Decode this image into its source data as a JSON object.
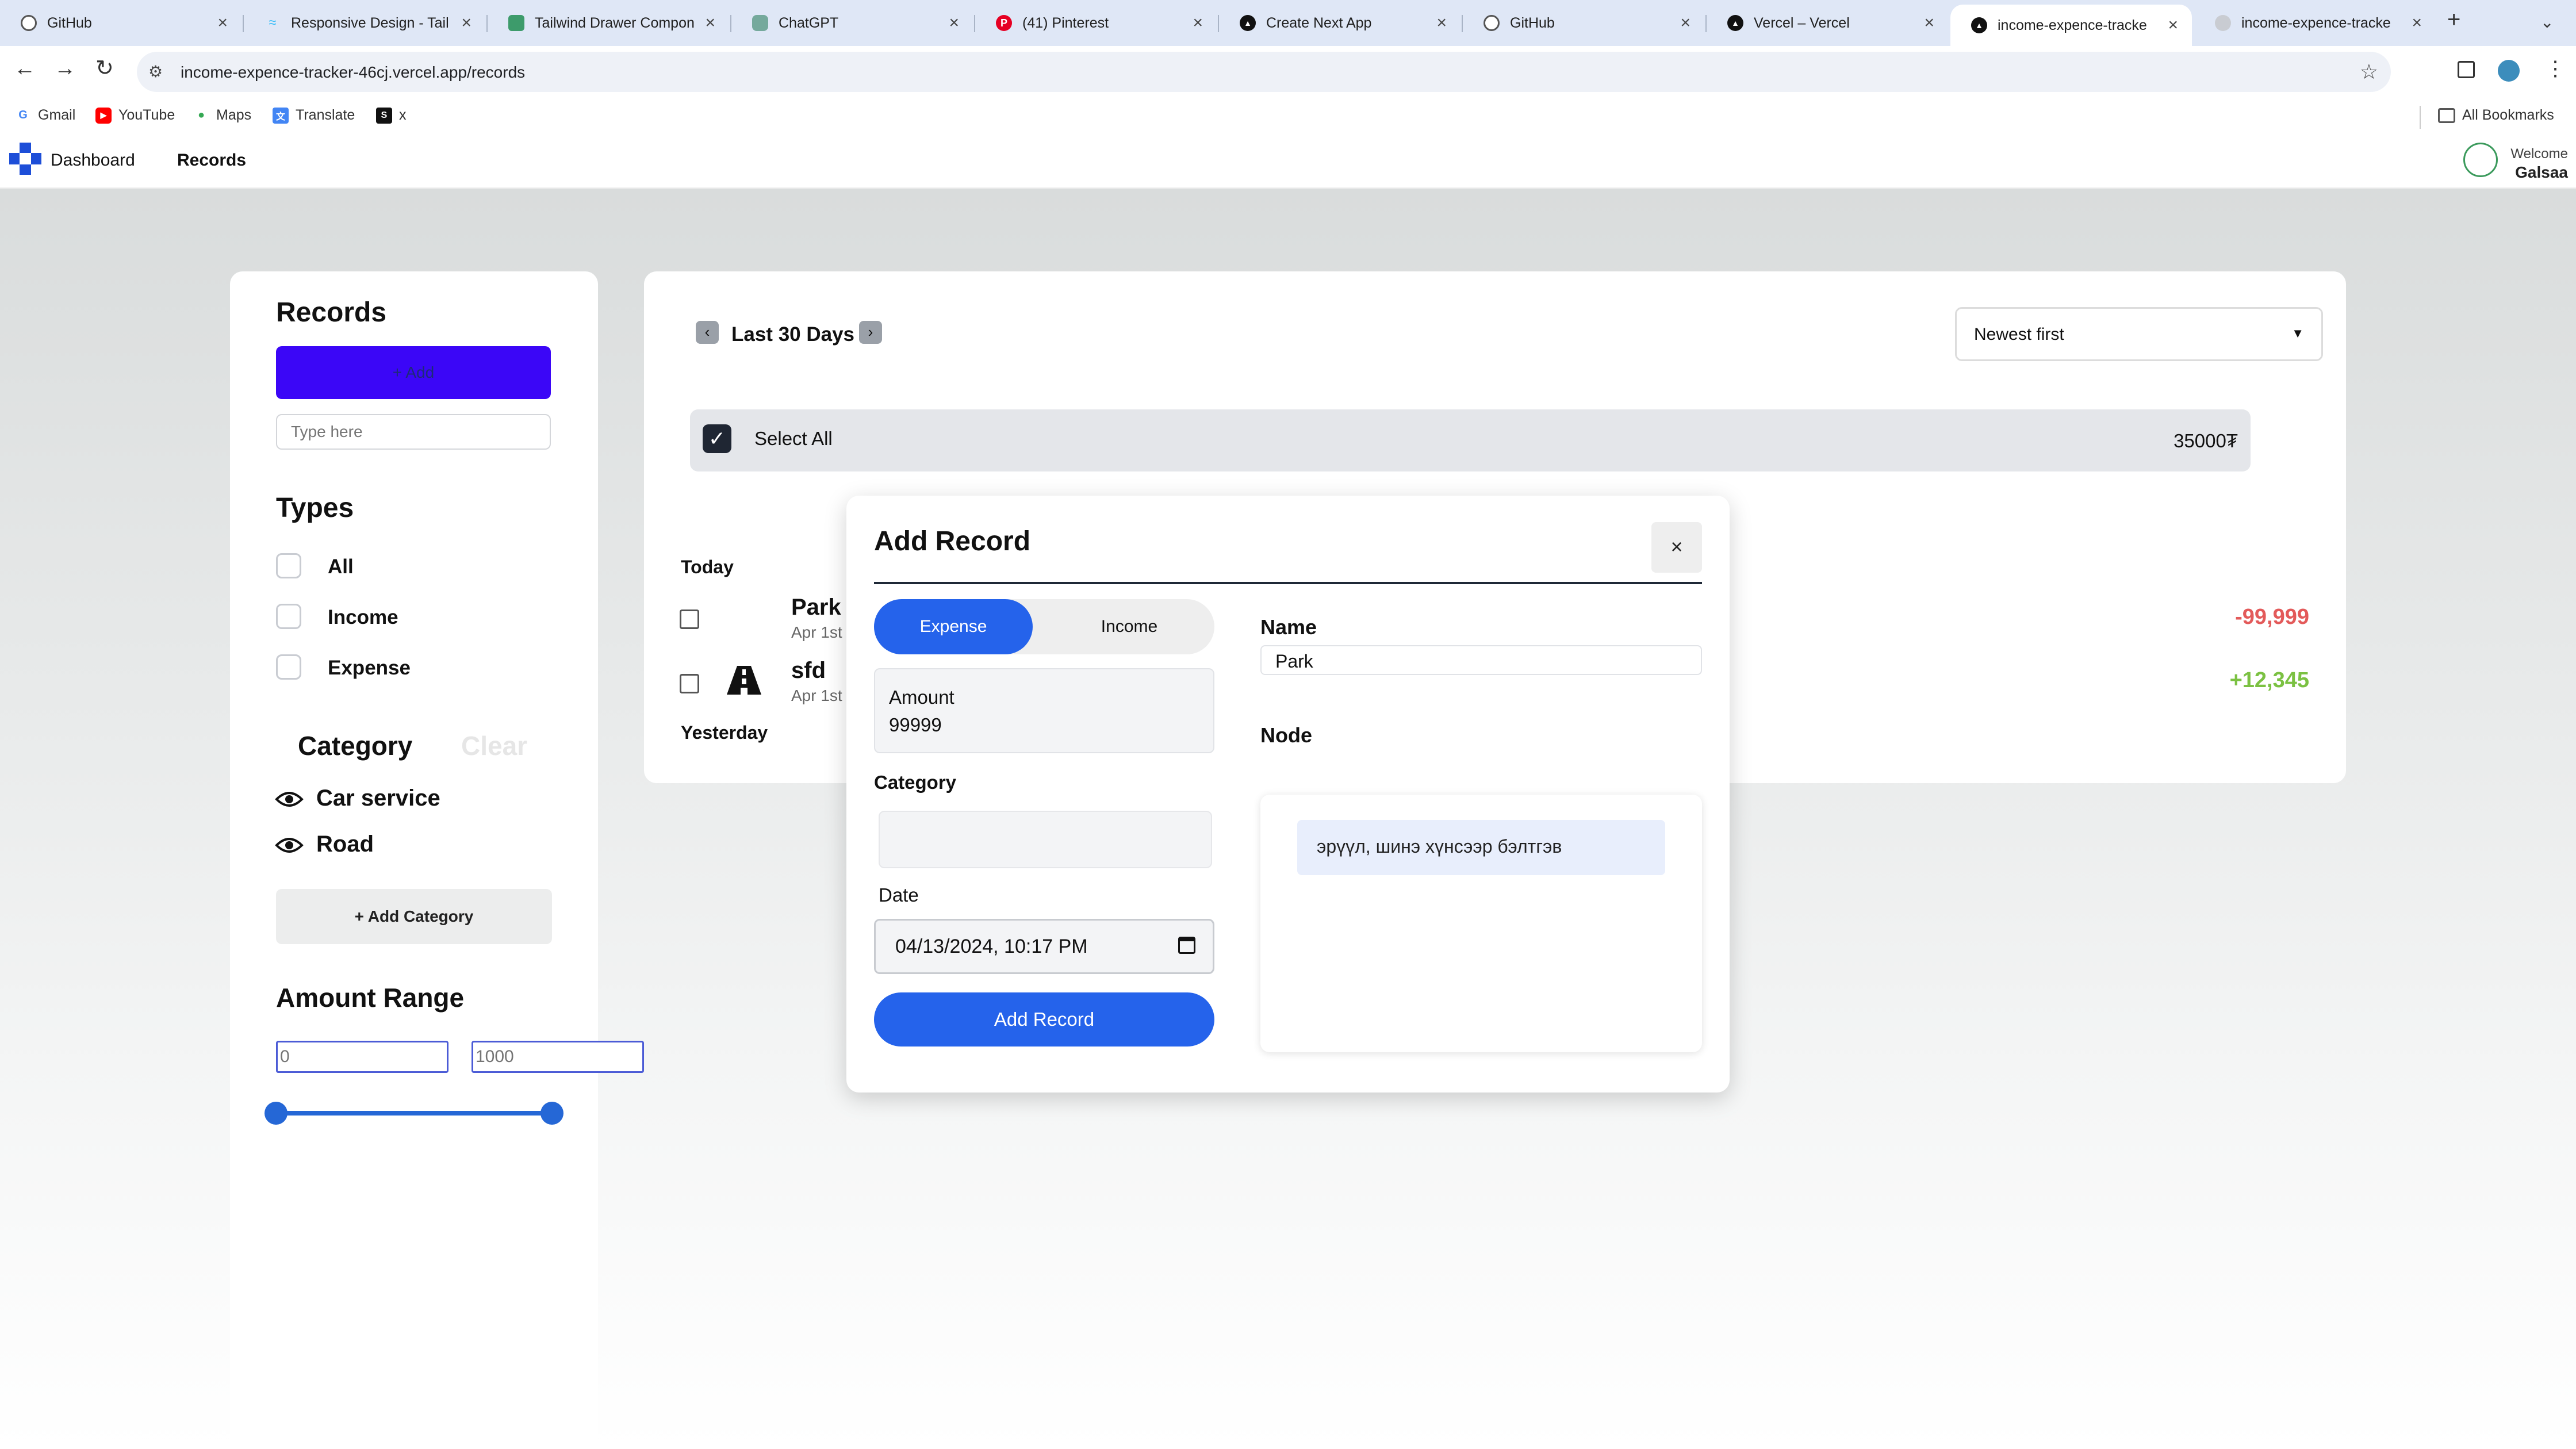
{
  "browser": {
    "tabs": [
      {
        "title": "GitHub",
        "icon": "github-icon"
      },
      {
        "title": "Responsive Design - Tail",
        "icon": "tailwind-icon"
      },
      {
        "title": "Tailwind Drawer Compon",
        "icon": "page-icon"
      },
      {
        "title": "ChatGPT",
        "icon": "chatgpt-icon"
      },
      {
        "title": "(41) Pinterest",
        "icon": "pinterest-icon"
      },
      {
        "title": "Create Next App",
        "icon": "vercel-icon"
      },
      {
        "title": "GitHub",
        "icon": "github-icon"
      },
      {
        "title": "Vercel – Vercel",
        "icon": "vercel-icon"
      },
      {
        "title": "income-expence-tracke",
        "icon": "vercel-icon"
      },
      {
        "title": "income-expence-tracke",
        "icon": "globe-icon"
      }
    ],
    "active_tab_index": 8,
    "url": "income-expence-tracker-46cj.vercel.app/records",
    "bookmarks": [
      "Gmail",
      "YouTube",
      "Maps",
      "Translate",
      "x"
    ],
    "all_bookmarks": "All Bookmarks"
  },
  "app": {
    "nav": {
      "dashboard": "Dashboard",
      "records": "Records"
    },
    "user": {
      "welcome": "Welcome",
      "name": "Galsaa"
    }
  },
  "sidebar": {
    "title": "Records",
    "add_button": "+ Add",
    "search_placeholder": "Type here",
    "types_title": "Types",
    "types": [
      "All",
      "Income",
      "Expense"
    ],
    "category_title": "Category",
    "clear_label": "Clear",
    "categories": [
      "Car service",
      "Road"
    ],
    "add_category": "+ Add Category",
    "amount_range_title": "Amount Range",
    "range_min_placeholder": "0",
    "range_max_placeholder": "1000"
  },
  "records": {
    "period": "Last 30 Days",
    "sort": "Newest first",
    "select_all": "Select All",
    "total": "35000₮",
    "groups": [
      {
        "label": "Today",
        "items": [
          {
            "name": "Park",
            "date": "Apr 1st",
            "amount": "-99,999",
            "color": "#e35a5a"
          },
          {
            "name": "sfd",
            "date": "Apr 1st",
            "amount": "+12,345",
            "color": "#7bc142"
          }
        ]
      },
      {
        "label": "Yesterday",
        "items": []
      }
    ]
  },
  "modal": {
    "title": "Add Record",
    "tab_expense": "Expense",
    "tab_income": "Income",
    "amount_label": "Amount",
    "amount_value": "99999",
    "category_label": "Category",
    "date_label": "Date",
    "date_value": "04/13/2024, 10:17 PM",
    "submit": "Add Record",
    "name_label": "Name",
    "name_value": "Park",
    "node_label": "Node",
    "node_value": "эрүүл, шинэ хүнсээр бэлтгэв"
  },
  "colors": {
    "primary": "#2563eb",
    "add_button": "#3b06f7",
    "expense_red": "#e35a5a",
    "income_green": "#7bc142"
  }
}
